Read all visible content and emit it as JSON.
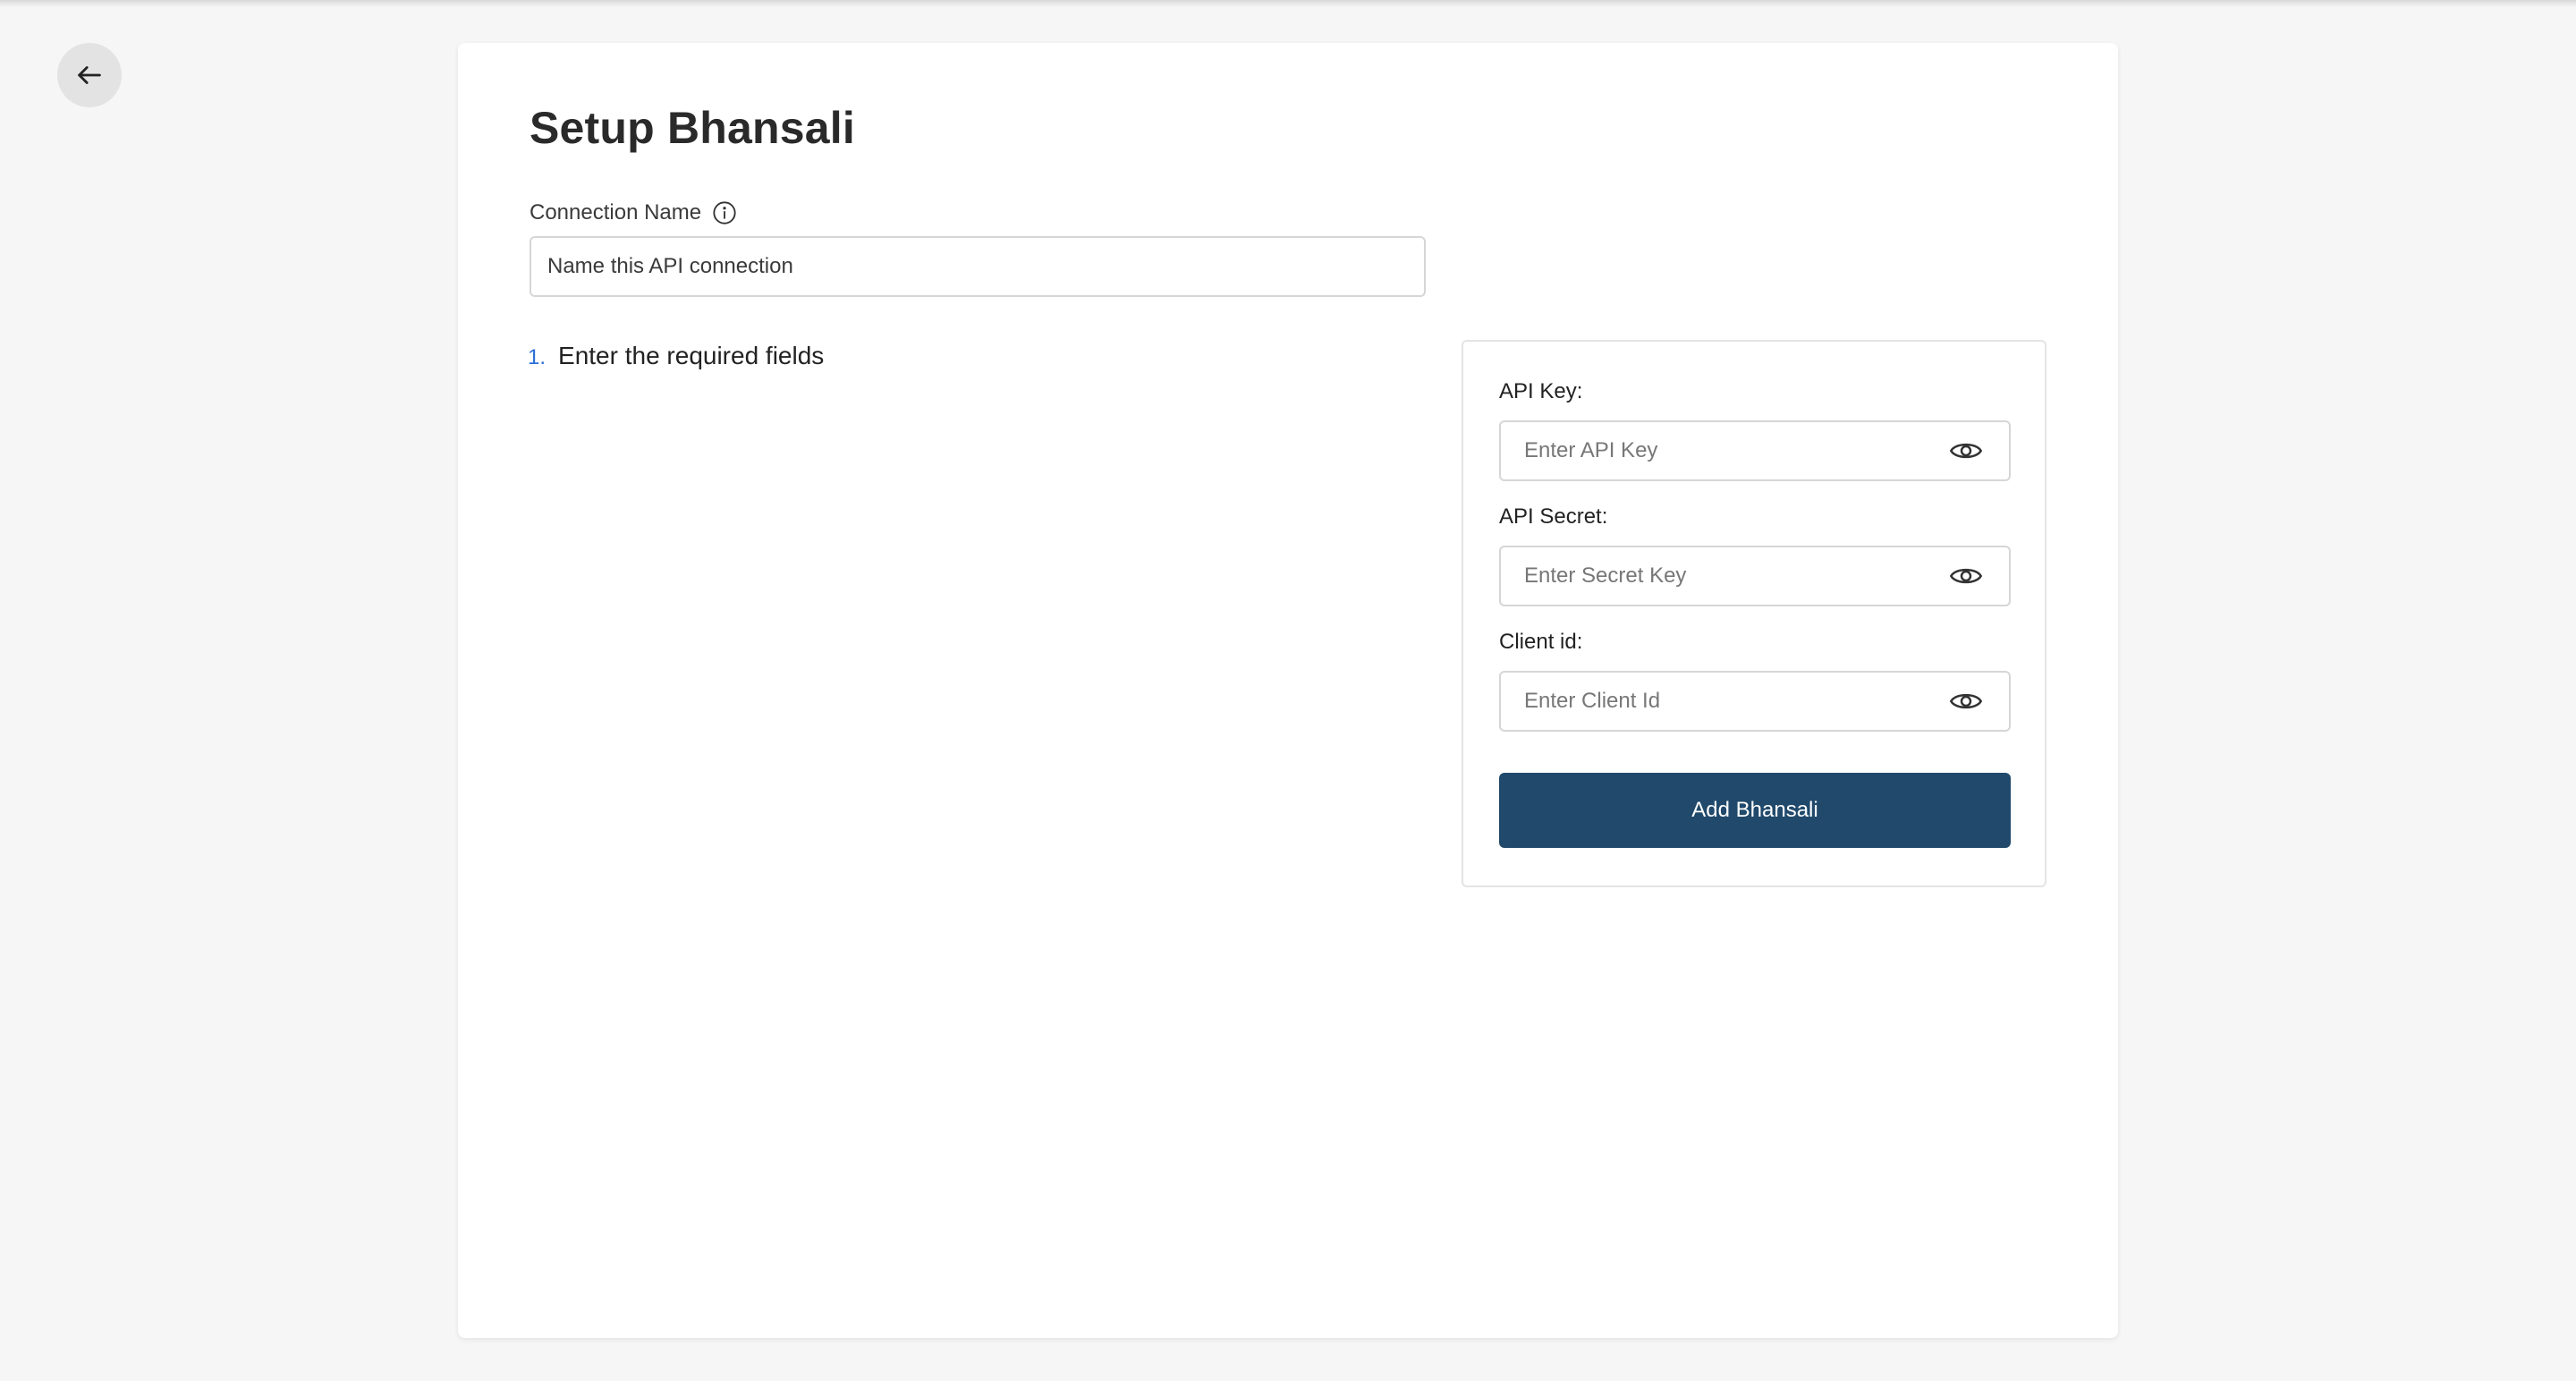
{
  "nav": {
    "back_icon": "arrow-left-icon"
  },
  "page": {
    "title": "Setup Bhansali"
  },
  "connection": {
    "label": "Connection Name",
    "info_icon": "info-icon",
    "placeholder": "Name this API connection"
  },
  "steps": [
    {
      "number": "1.",
      "text": "Enter the required fields"
    }
  ],
  "fields": [
    {
      "label": "API Key:",
      "placeholder": "Enter API Key",
      "icon": "eye-icon"
    },
    {
      "label": "API Secret:",
      "placeholder": "Enter Secret Key",
      "icon": "eye-icon"
    },
    {
      "label": "Client id:",
      "placeholder": "Enter Client Id",
      "icon": "eye-icon"
    }
  ],
  "actions": {
    "submit_label": "Add Bhansali"
  },
  "colors": {
    "background": "#f6f6f6",
    "card": "#ffffff",
    "primary_button": "#20496b",
    "step_number": "#2a6fd6"
  }
}
